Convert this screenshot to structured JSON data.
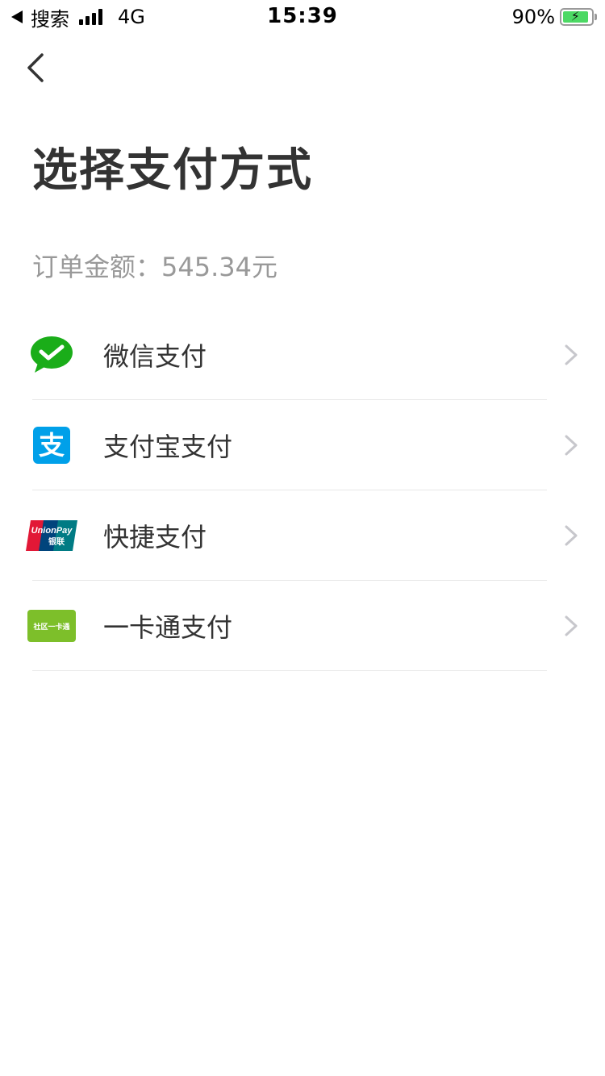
{
  "status_bar": {
    "back_label": "搜索",
    "network": "4G",
    "time": "15:39",
    "battery_percent": "90%",
    "battery_level": 0.9
  },
  "nav": {
    "back_icon": "chevron-left-icon"
  },
  "page_title": "选择支付方式",
  "order_amount": "订单金额：545.34元",
  "payment_methods": [
    {
      "label": "微信支付",
      "icon": "wechat-pay-icon",
      "color": "#1aad19"
    },
    {
      "label": "支付宝支付",
      "icon": "alipay-icon",
      "color": "#00a0e9",
      "icon_text": "支"
    },
    {
      "label": "快捷支付",
      "icon": "unionpay-icon",
      "icon_text": "UnionPay",
      "icon_text_cn": "银联"
    },
    {
      "label": "一卡通支付",
      "icon": "community-card-icon",
      "color": "#7dbf2a",
      "icon_text": "社区一卡通"
    }
  ],
  "colors": {
    "title": "#333333",
    "subtitle": "#999999",
    "divider": "#e8e8e8",
    "chevron": "#c7c7cc"
  }
}
